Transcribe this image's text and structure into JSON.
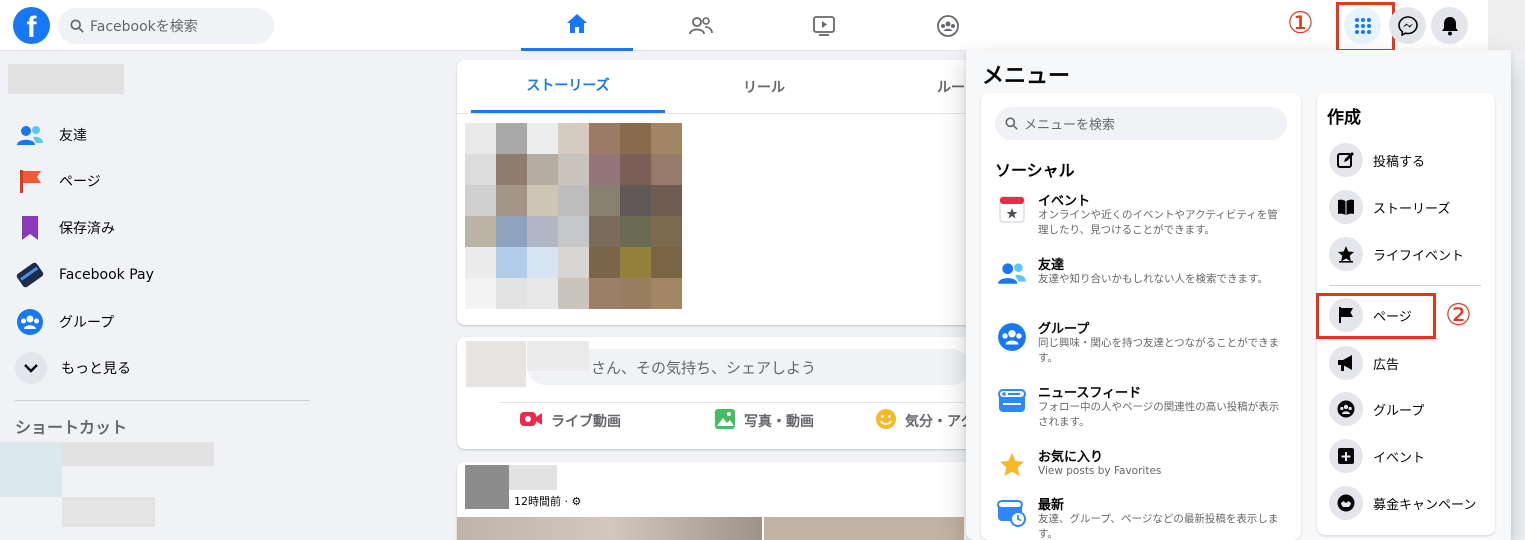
{
  "header": {
    "logo": "f",
    "search_placeholder": "Facebookを検索",
    "nav_icons": [
      "home-icon",
      "friends-icon",
      "watch-icon",
      "groups-icon"
    ],
    "right_icons": [
      "menu-grid-icon",
      "messenger-icon",
      "notifications-icon"
    ],
    "annotation_1": "①"
  },
  "sidebar": {
    "items": [
      {
        "label": "友達",
        "icon": "friends-icon"
      },
      {
        "label": "ページ",
        "icon": "page-flag-icon"
      },
      {
        "label": "保存済み",
        "icon": "bookmark-icon"
      },
      {
        "label": "Facebook Pay",
        "icon": "payment-card-icon"
      },
      {
        "label": "グループ",
        "icon": "groups-icon"
      },
      {
        "label": "もっと見る",
        "icon": "chevron-down-icon"
      }
    ],
    "shortcuts_title": "ショートカット"
  },
  "feed": {
    "tabs": [
      "ストーリーズ",
      "リール",
      "ルー"
    ],
    "compose_placeholder": "さん、その気持ち、シェアしよう",
    "compose_actions": [
      "ライブ動画",
      "写真・動画",
      "気分・アク"
    ],
    "post_time": "12時間前 · ⚙"
  },
  "menu": {
    "title": "メニュー",
    "search_placeholder": "メニューを検索",
    "social_heading": "ソーシャル",
    "social_items": [
      {
        "title": "イベント",
        "desc": "オンラインや近くのイベントやアクティビティを管理したり、見つけることができます。"
      },
      {
        "title": "友達",
        "desc": "友達や知り合いかもしれない人を検索できます。"
      },
      {
        "title": "グループ",
        "desc": "同じ興味・関心を持つ友達とつながることができます。"
      },
      {
        "title": "ニュースフィード",
        "desc": "フォロー中の人やページの関連性の高い投稿が表示されます。"
      },
      {
        "title": "お気に入り",
        "desc": "View posts by Favorites"
      },
      {
        "title": "最新",
        "desc": "友達、グループ、ページなどの最新投稿を表示します。"
      }
    ],
    "create_heading": "作成",
    "create_items": [
      {
        "label": "投稿する"
      },
      {
        "label": "ストーリーズ"
      },
      {
        "label": "ライフイベント"
      },
      {
        "label": "ページ"
      },
      {
        "label": "広告"
      },
      {
        "label": "グループ"
      },
      {
        "label": "イベント"
      },
      {
        "label": "募金キャンペーン"
      }
    ],
    "annotation_2": "②"
  },
  "colors": {
    "brand": "#1877f2",
    "annotation": "#e8361e"
  }
}
